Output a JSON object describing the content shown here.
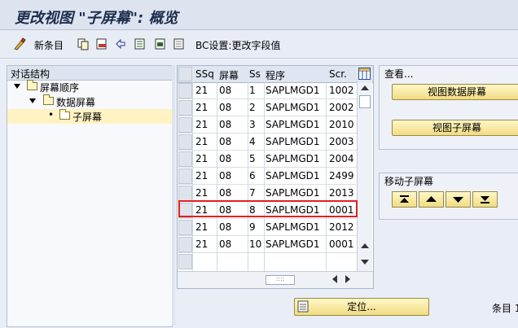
{
  "title": "更改视图 \"子屏幕\": 概览",
  "toolbar": {
    "new_entry_label": "新条目",
    "bc_set_label": "BC设置:更改字段值"
  },
  "tree": {
    "header": "对话结构",
    "nodes": [
      {
        "label": "屏幕顺序"
      },
      {
        "label": "数据屏幕"
      },
      {
        "label": "子屏幕"
      }
    ]
  },
  "table": {
    "headers": [
      "SSq",
      "屏幕",
      "Ss",
      "程序",
      "Scr."
    ],
    "rows": [
      [
        "21",
        "08",
        "1",
        "SAPLMGD1",
        "1002"
      ],
      [
        "21",
        "08",
        "2",
        "SAPLMGD1",
        "2002"
      ],
      [
        "21",
        "08",
        "3",
        "SAPLMGD1",
        "2010"
      ],
      [
        "21",
        "08",
        "4",
        "SAPLMGD1",
        "2003"
      ],
      [
        "21",
        "08",
        "5",
        "SAPLMGD1",
        "2004"
      ],
      [
        "21",
        "08",
        "6",
        "SAPLMGD1",
        "2499"
      ],
      [
        "21",
        "08",
        "7",
        "SAPLMGD1",
        "2013"
      ],
      [
        "21",
        "08",
        "8",
        "SAPLMGD1",
        "0001"
      ],
      [
        "21",
        "08",
        "9",
        "SAPLMGD1",
        "2012"
      ],
      [
        "21",
        "08",
        "10",
        "SAPLMGD1",
        "0001"
      ]
    ],
    "highlighted_row": 7
  },
  "view_group": {
    "title": "查看...",
    "btn_view_data_screen": "视图数据屏幕",
    "btn_view_sub_screen": "视图子屏幕"
  },
  "move_group": {
    "title": "移动子屏幕"
  },
  "position_button": "定位...",
  "entry_label": "条目 1",
  "colors": {
    "highlight": "#e02020",
    "button": "#f1dc83"
  }
}
